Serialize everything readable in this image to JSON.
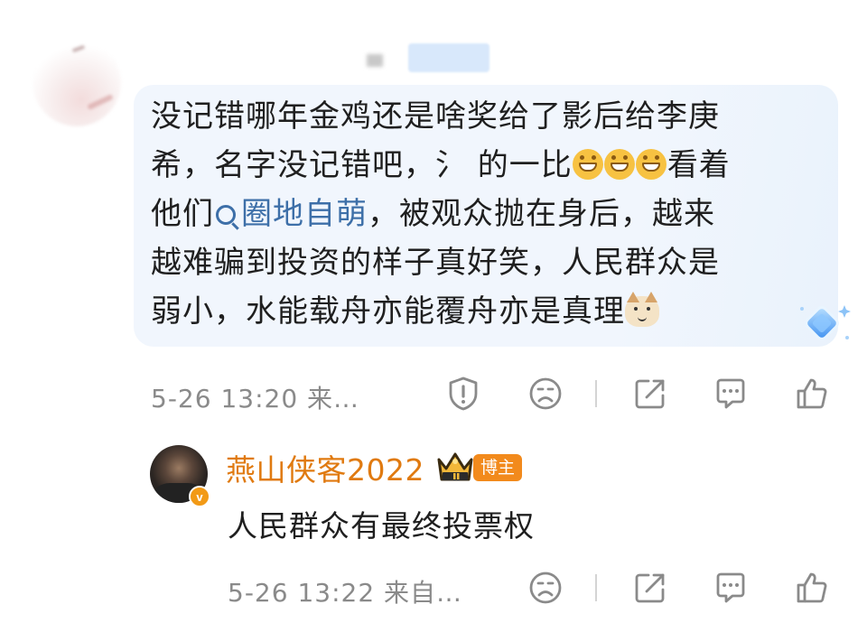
{
  "comment": {
    "text_line1": "没记错哪年金鸡还是啥奖给了影后给李庚",
    "text_line2_a": "希，名字没记错吧，氵 的一比",
    "text_line2_b": "看着",
    "text_line3_a": "他们",
    "topic": "圈地自萌",
    "text_line3_b": "，被观众抛在身后，越来",
    "text_line4": "越难骗到投资的样子真好笑，人民群众是",
    "text_line5": "弱小，水能载舟亦能覆舟亦是真理",
    "meta": "5-26 13:20 来…",
    "emojis": [
      "grinning-face",
      "grinning-face",
      "grinning-face",
      "cat-face"
    ]
  },
  "reply": {
    "username": "燕山侠客2022",
    "author_tag": "博主",
    "verified_mark": "v",
    "text": "人民群众有最终投票权",
    "meta": "5-26 13:22 来自…"
  },
  "icons": {
    "report": "report-icon",
    "dislike": "dislike-icon",
    "share": "share-icon",
    "comment": "comment-icon",
    "like": "like-icon"
  },
  "colors": {
    "bubble_bg": "#f1f6fd",
    "topic_link": "#3d6fa8",
    "username": "#e07a10",
    "author_tag_bg": "#f28a1c",
    "meta_text": "#8a8a8a"
  }
}
